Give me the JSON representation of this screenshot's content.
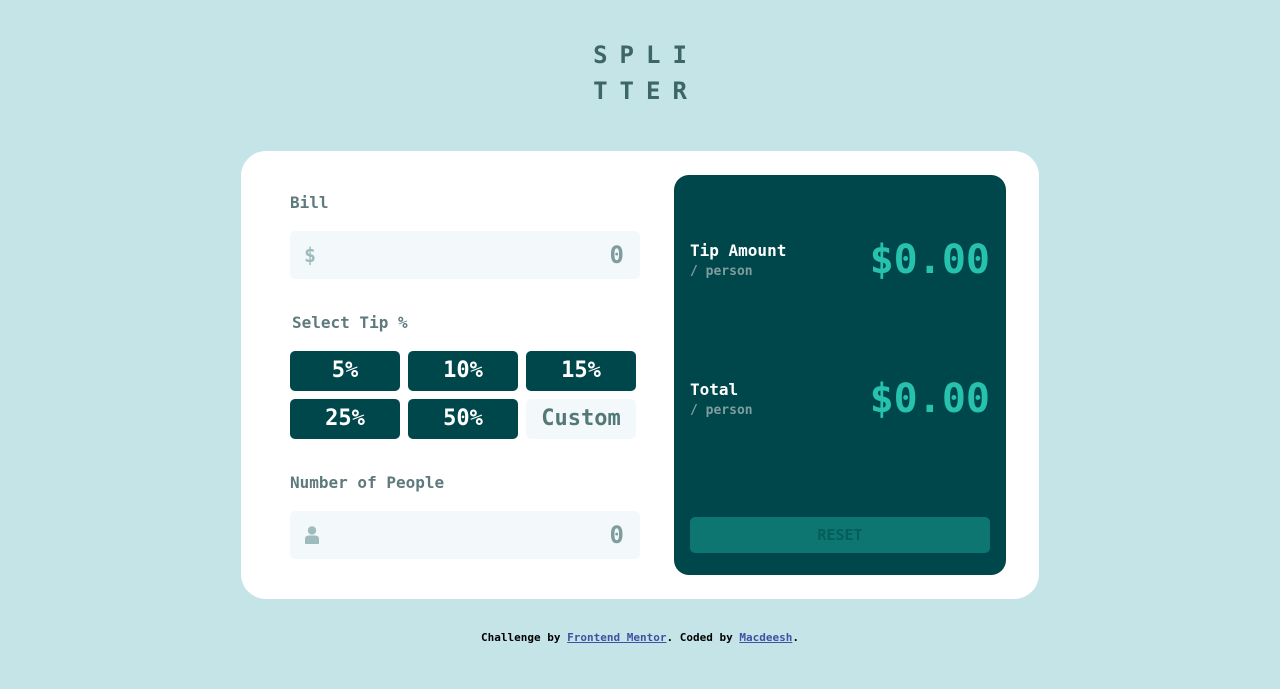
{
  "logo": {
    "line1": "SPLI",
    "line2": "TTER"
  },
  "bill": {
    "label": "Bill",
    "prefix": "$",
    "value": "0"
  },
  "tip": {
    "label": "Select Tip %",
    "options": [
      "5%",
      "10%",
      "15%",
      "25%",
      "50%"
    ],
    "custom_placeholder": "Custom"
  },
  "people": {
    "label": "Number of People",
    "value": "0",
    "icon": "person-icon"
  },
  "results": {
    "tip_title": "Tip Amount",
    "tip_sub": "/ person",
    "tip_value": "$0.00",
    "total_title": "Total",
    "total_sub": "/ person",
    "total_value": "$0.00",
    "reset_label": "RESET"
  },
  "footer": {
    "prefix": "Challenge by ",
    "link1": "Frontend Mentor",
    "middle": ". Coded by ",
    "link2": "Macdeesh",
    "suffix": "."
  },
  "colors": {
    "background": "#c5e4e7",
    "dark_cyan": "#00474b",
    "accent": "#26c2ad",
    "input_bg": "#f3f9fa"
  }
}
